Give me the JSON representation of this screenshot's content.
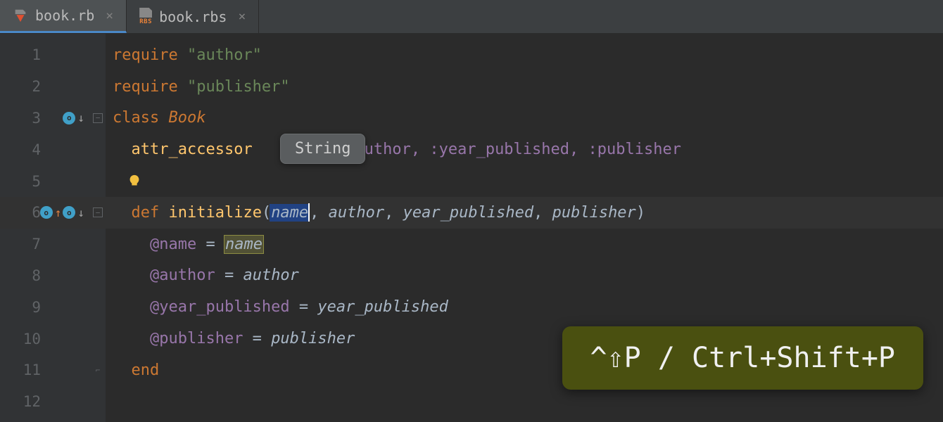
{
  "tabs": [
    {
      "label": "book.rb",
      "active": true,
      "icon": "ruby"
    },
    {
      "label": "book.rbs",
      "active": false,
      "icon": "rbs"
    }
  ],
  "tooltip": {
    "text": "String"
  },
  "shortcut": {
    "text": "^⇧P / Ctrl+Shift+P"
  },
  "gutter": {
    "lines": [
      "1",
      "2",
      "3",
      "4",
      "5",
      "6",
      "7",
      "8",
      "9",
      "10",
      "11",
      "12"
    ]
  },
  "code": {
    "l1": {
      "kw": "require",
      "str": "\"author\""
    },
    "l2": {
      "kw": "require",
      "str": "\"publisher\""
    },
    "l3": {
      "kw": "class ",
      "name": "Book"
    },
    "l4": {
      "fn": "attr_accessor",
      "rest_syms": ":author, :year_published, :publisher"
    },
    "l6": {
      "kw": "def ",
      "fn": "initialize",
      "open": "(",
      "p1": "name",
      "c1": ", ",
      "p2": "author",
      "c2": ", ",
      "p3": "year_published",
      "c3": ", ",
      "p4": "publisher",
      "close": ")"
    },
    "l7": {
      "indent": "    ",
      "ivar": "@name",
      "eq": " = ",
      "rhs": "name"
    },
    "l8": {
      "indent": "    ",
      "ivar": "@author",
      "eq": " = ",
      "rhs": "author"
    },
    "l9": {
      "indent": "    ",
      "ivar": "@year_published",
      "eq": " = ",
      "rhs": "year_published"
    },
    "l10": {
      "indent": "    ",
      "ivar": "@publisher",
      "eq": " = ",
      "rhs": "publisher"
    },
    "l11": {
      "indent": "  ",
      "kw": "end"
    }
  }
}
